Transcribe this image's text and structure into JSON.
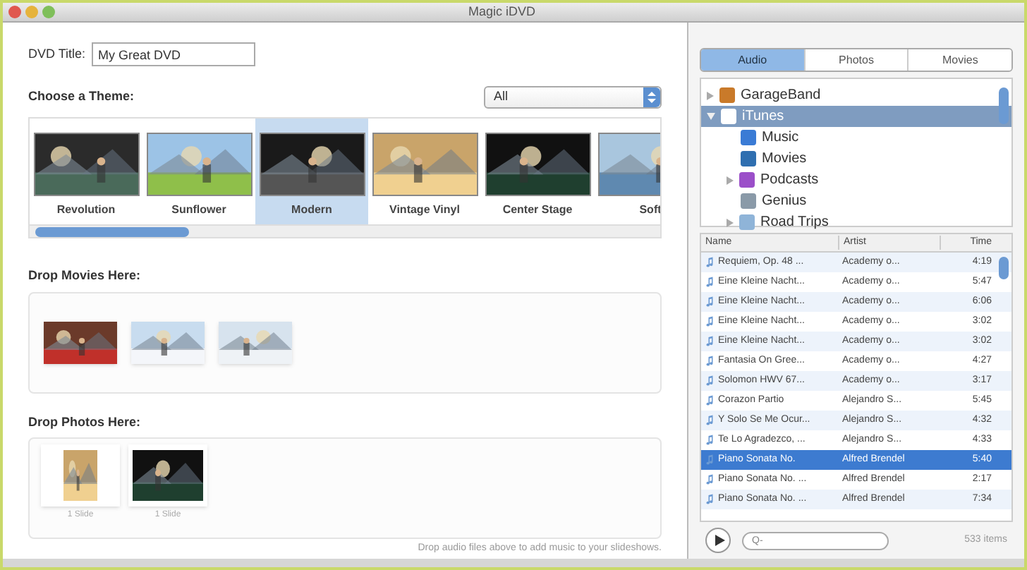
{
  "window": {
    "title": "Magic iDVD"
  },
  "dvd_title": {
    "label": "DVD Title:",
    "value": "My Great DVD"
  },
  "themes": {
    "heading": "Choose a Theme:",
    "filter": "All",
    "items": [
      {
        "label": "Revolution",
        "selected": false
      },
      {
        "label": "Sunflower",
        "selected": false
      },
      {
        "label": "Modern",
        "selected": true
      },
      {
        "label": "Vintage Vinyl",
        "selected": false
      },
      {
        "label": "Center Stage",
        "selected": false
      },
      {
        "label": "Soft",
        "selected": false
      }
    ]
  },
  "movies": {
    "heading": "Drop Movies Here:"
  },
  "photos": {
    "heading": "Drop Photos Here:",
    "items": [
      {
        "caption": "1 Slide"
      },
      {
        "caption": "1 Slide"
      }
    ]
  },
  "hint": "Drop audio files above to add music to your slideshows.",
  "media_tabs": [
    {
      "label": "Audio",
      "selected": true
    },
    {
      "label": "Photos",
      "selected": false
    },
    {
      "label": "Movies",
      "selected": false
    }
  ],
  "sources": [
    {
      "label": "GarageBand",
      "expanded": false,
      "selected": false
    },
    {
      "label": "iTunes",
      "expanded": true,
      "selected": true,
      "children": [
        {
          "label": "Music",
          "selected": false
        },
        {
          "label": "Movies",
          "selected": false
        },
        {
          "label": "Podcasts",
          "expanded": false,
          "selected": false
        },
        {
          "label": "Genius",
          "selected": false
        },
        {
          "label": "Road Trips",
          "expanded": false,
          "selected": false
        }
      ]
    }
  ],
  "tracks": {
    "columns": [
      "Name",
      "Artist",
      "Time"
    ],
    "rows": [
      {
        "name": "Requiem, Op. 48 ...",
        "artist": "Academy o...",
        "time": "4:19",
        "selected": false
      },
      {
        "name": "Eine Kleine Nacht...",
        "artist": "Academy o...",
        "time": "5:47",
        "selected": false
      },
      {
        "name": "Eine Kleine Nacht...",
        "artist": "Academy o...",
        "time": "6:06",
        "selected": false
      },
      {
        "name": "Eine Kleine Nacht...",
        "artist": "Academy o...",
        "time": "3:02",
        "selected": false
      },
      {
        "name": "Eine Kleine Nacht...",
        "artist": "Academy o...",
        "time": "3:02",
        "selected": false
      },
      {
        "name": "Fantasia On Gree...",
        "artist": "Academy o...",
        "time": "4:27",
        "selected": false
      },
      {
        "name": "Solomon HWV 67...",
        "artist": "Academy o...",
        "time": "3:17",
        "selected": false
      },
      {
        "name": "Corazon Partio",
        "artist": "Alejandro S...",
        "time": "5:45",
        "selected": false
      },
      {
        "name": "Y Solo Se Me Ocur...",
        "artist": "Alejandro S...",
        "time": "4:32",
        "selected": false
      },
      {
        "name": "Te Lo Agradezco, ...",
        "artist": "Alejandro S...",
        "time": "4:33",
        "selected": false
      },
      {
        "name": "Piano Sonata No.",
        "artist": "Alfred Brendel",
        "time": "5:40",
        "selected": true
      },
      {
        "name": "Piano Sonata No. ...",
        "artist": "Alfred Brendel",
        "time": "2:17",
        "selected": false
      },
      {
        "name": "Piano Sonata No. ...",
        "artist": "Alfred Brendel",
        "time": "7:34",
        "selected": false
      }
    ]
  },
  "search": {
    "placeholder": "Q-"
  },
  "item_count": "533 items"
}
